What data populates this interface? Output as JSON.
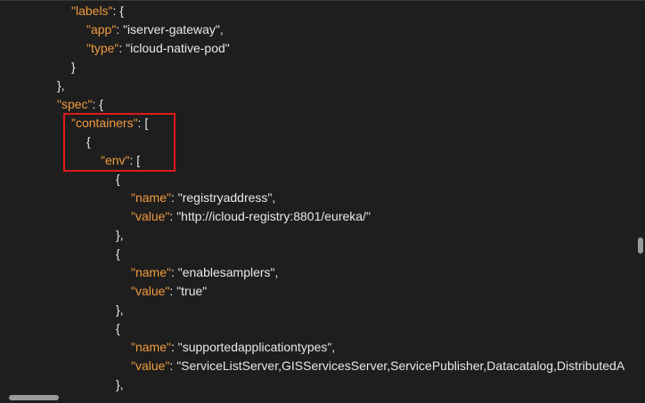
{
  "editor": {
    "lines": [
      {
        "k": "\"labels\"",
        "rest": ": {"
      },
      {
        "k": "\"app\"",
        "rest": ": \"iserver-gateway\","
      },
      {
        "k": "\"type\"",
        "rest": ": \"icloud-native-pod\""
      },
      {
        "k": "",
        "rest": "}"
      },
      {
        "k": "",
        "rest": "},"
      },
      {
        "k": "\"spec\"",
        "rest": ": {"
      },
      {
        "k": "\"containers\"",
        "rest": ": ["
      },
      {
        "k": "",
        "rest": "{"
      },
      {
        "k": "\"env\"",
        "rest": ": ["
      },
      {
        "k": "",
        "rest": "{"
      },
      {
        "k": "\"name\"",
        "rest": ": \"registryaddress\","
      },
      {
        "k": "\"value\"",
        "rest": ": \"http://icloud-registry:8801/eureka/\""
      },
      {
        "k": "",
        "rest": "},"
      },
      {
        "k": "",
        "rest": "{"
      },
      {
        "k": "\"name\"",
        "rest": ": \"enablesamplers\","
      },
      {
        "k": "\"value\"",
        "rest": ": \"true\""
      },
      {
        "k": "",
        "rest": "},"
      },
      {
        "k": "",
        "rest": "{"
      },
      {
        "k": "\"name\"",
        "rest": ": \"supportedapplicationtypes\","
      },
      {
        "k": "\"value\"",
        "rest": ": \"ServiceListServer,GISServicesServer,ServicePublisher,Datacatalog,DistributedA"
      },
      {
        "k": "",
        "rest": "},"
      },
      {
        "k": "",
        "rest": "{"
      }
    ]
  },
  "colors": {
    "key": "#f29b3e",
    "text": "#e8e8e8",
    "background": "#1e1e1e",
    "highlight": "#e01a1a"
  }
}
